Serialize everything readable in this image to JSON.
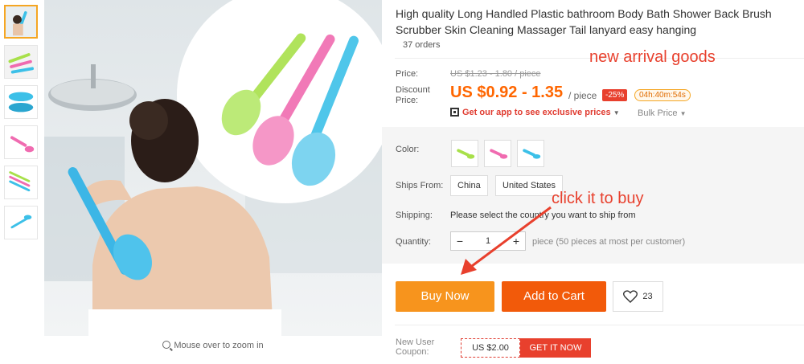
{
  "product": {
    "title": "High quality Long Handled Plastic bathroom Body Bath Shower Back Brush Scrubber Skin Cleaning Massager Tail lanyard easy hanging",
    "orders": "37 orders"
  },
  "gallery": {
    "zoom_hint": "Mouse over to zoom in",
    "thumbnails": [
      "thumb-1",
      "thumb-2",
      "thumb-3",
      "thumb-4",
      "thumb-5",
      "thumb-6"
    ]
  },
  "price": {
    "label": "Price:",
    "original": "US $1.23 - 1.80 / piece",
    "discount_label": "Discount Price:",
    "current": "US $0.92 - 1.35",
    "unit": "/ piece",
    "discount_badge": "-25%",
    "timer": "04h:40m:54s",
    "app_offer": "Get our app to see exclusive prices",
    "bulk": "Bulk Price"
  },
  "options": {
    "color_label": "Color:",
    "colors": [
      "#a8e04a",
      "#f06bb0",
      "#3cc0e8"
    ],
    "ships_from_label": "Ships From:",
    "ships_from": [
      "China",
      "United States"
    ],
    "shipping_label": "Shipping:",
    "shipping_text": "Please select the country you want to ship from",
    "quantity_label": "Quantity:",
    "quantity": "1",
    "quantity_note": "piece (50 pieces at most per customer)"
  },
  "actions": {
    "buy_now": "Buy Now",
    "add_to_cart": "Add to Cart",
    "wishlist_count": "23"
  },
  "coupon": {
    "label": "New User Coupon:",
    "value": "US $2.00",
    "button": "GET IT NOW"
  },
  "annotations": {
    "new_arrival": "new arrival goods",
    "click_to_buy": "click it to buy"
  },
  "colors": {
    "accent_orange": "#f7941d",
    "cart_orange": "#f25a0a",
    "price_orange": "#ff6600",
    "annotation_red": "#e8402d"
  }
}
